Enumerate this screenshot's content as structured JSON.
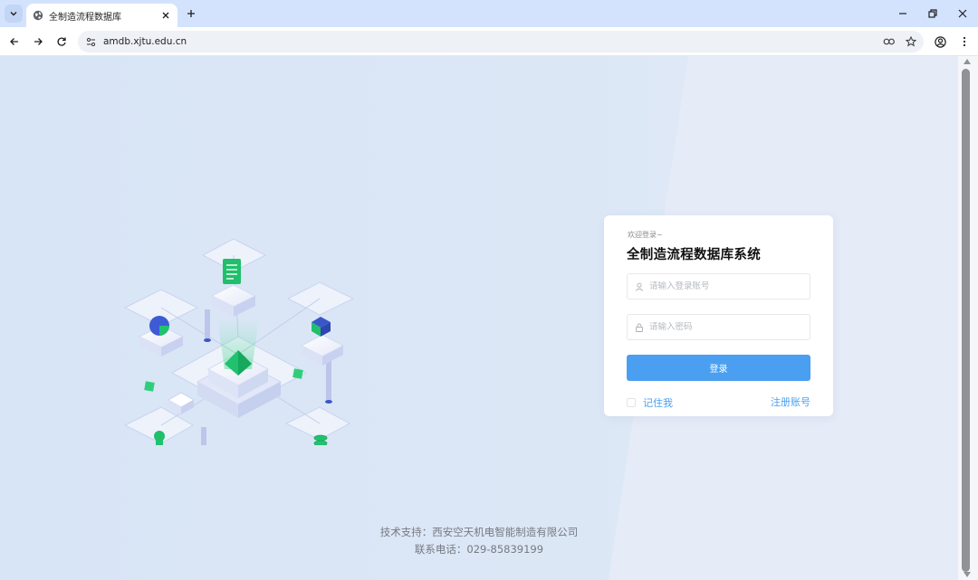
{
  "browser": {
    "tab_title": "全制造流程数据库",
    "url": "amdb.xjtu.edu.cn",
    "icons": {
      "tab_menu": "chevron-down-icon",
      "favicon": "globe-icon",
      "tab_close": "close-icon",
      "new_tab": "plus-icon",
      "minimize": "minimize-icon",
      "restore": "restore-icon",
      "close_window": "close-icon",
      "back": "arrow-left-icon",
      "forward": "arrow-right-icon",
      "reload": "reload-icon",
      "site_info": "tune-icon",
      "password": "key-icon",
      "bookmark": "star-icon",
      "profile": "profile-icon",
      "menu": "more-vert-icon"
    }
  },
  "login": {
    "welcome": "欢迎登录~",
    "title": "全制造流程数据库系统",
    "username_placeholder": "请输入登录账号",
    "password_placeholder": "请输入密码",
    "submit_label": "登录",
    "remember_label": "记住我",
    "register_label": "注册账号"
  },
  "footer": {
    "support": "技术支持：西安空天机电智能制造有限公司",
    "phone": "联系电话：029-85839199"
  },
  "colors": {
    "accent": "#4a9ff0",
    "page_bg": "#dce6f5",
    "tabbar_bg": "#d3e3fd",
    "illustration_green": "#20c26e"
  }
}
